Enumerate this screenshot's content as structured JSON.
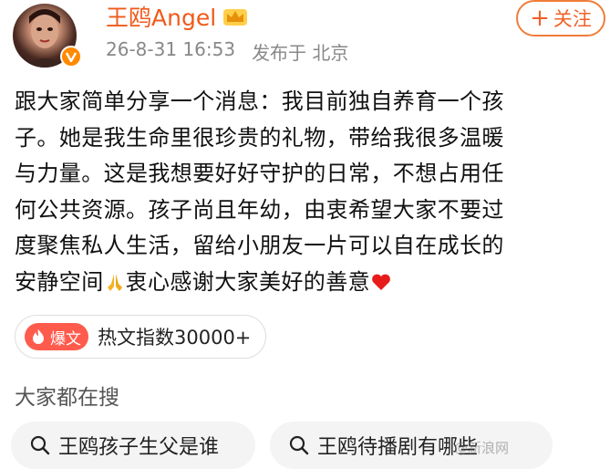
{
  "header": {
    "username": "王鸥Angel",
    "timestamp": "26-8-31 16:53",
    "location": "发布于 北京",
    "follow_label": "关注",
    "crown_icon": "crown-icon",
    "verified_icon": "verified-v-icon"
  },
  "post": {
    "line1": "跟大家简单分享一个消息：我目前独自养育一个孩",
    "line2": "子。她是我生命里很珍贵的礼物，带给我很多温暖",
    "line3": "与力量。这是我想要好好守护的日常，不想占用任",
    "line4": "何公共资源。孩子尚且年幼，由衷希望大家不要过",
    "line5": "度聚焦私人生活，留给小朋友一片可以自在成长的",
    "line6a": "安静空间",
    "line6b": "衷心感谢大家美好的善意"
  },
  "hot": {
    "badge": "爆文",
    "label": "热文指数30000+"
  },
  "search": {
    "heading": "大家都在搜",
    "items": [
      "王鸥孩子生父是谁",
      "王鸥待播剧有哪些"
    ]
  },
  "watermark": "@新浪网"
}
